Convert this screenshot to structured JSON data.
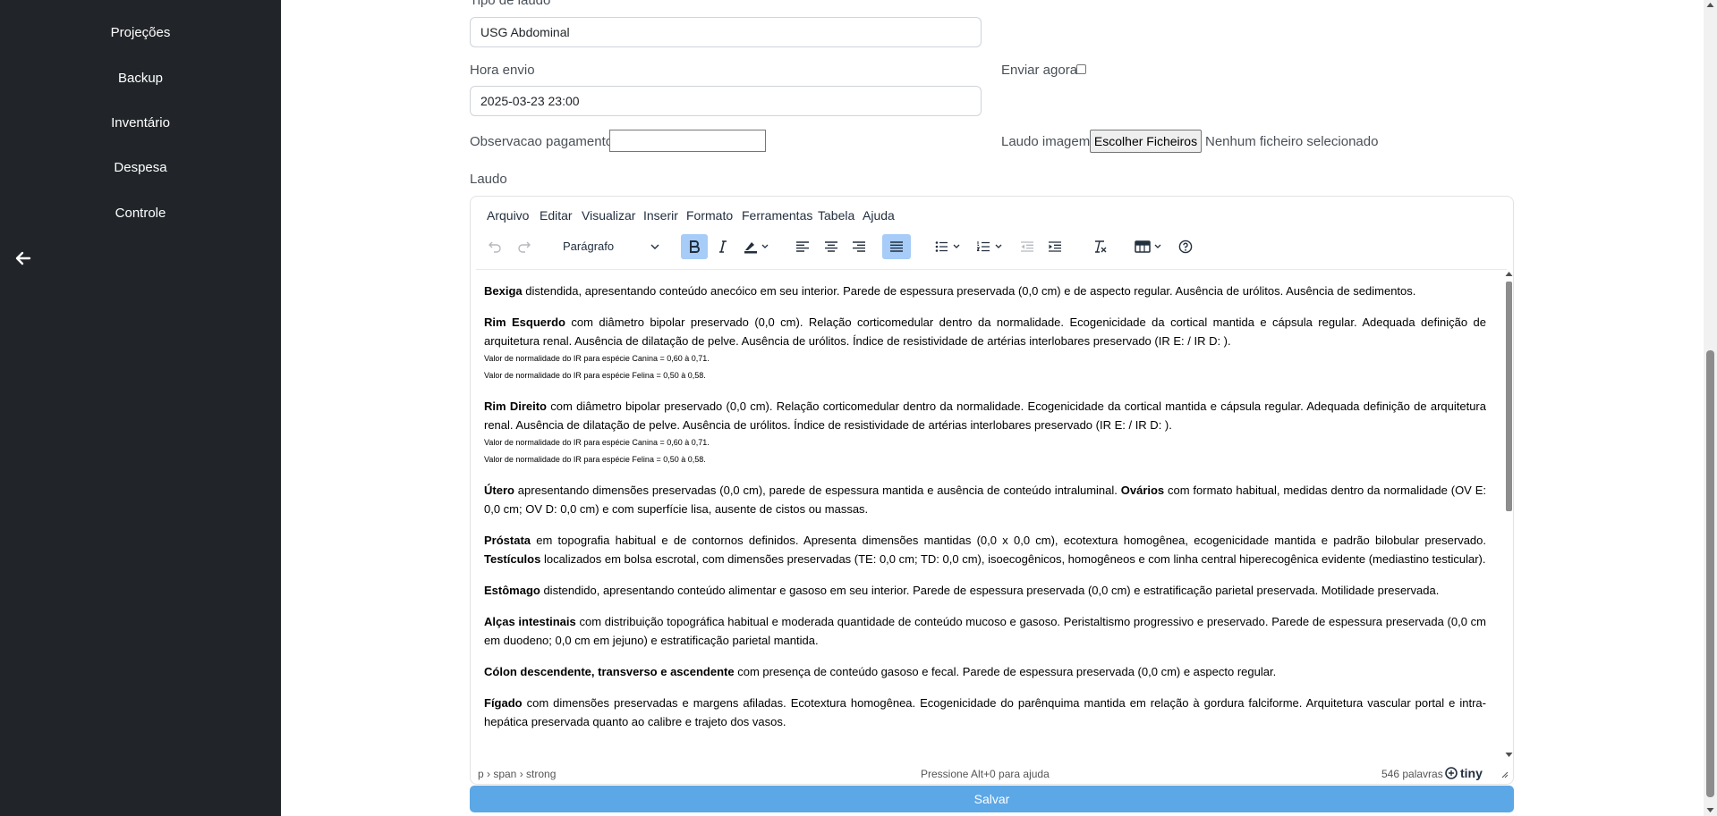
{
  "sidebar": {
    "items": [
      {
        "label": "Projeções"
      },
      {
        "label": "Backup"
      },
      {
        "label": "Inventário"
      },
      {
        "label": "Despesa"
      },
      {
        "label": "Controle"
      }
    ]
  },
  "form": {
    "tipo_label": "Tipo de laudo",
    "tipo_value": "USG Abdominal",
    "hora_label": "Hora envio",
    "hora_value": "2025-03-23 23:00",
    "enviar_label": "Enviar agora",
    "obs_label": "Observacao pagamento",
    "laudo_imagem_label": "Laudo imagem",
    "file_button": "Escolher Ficheiros",
    "file_status": "Nenhum ficheiro selecionado",
    "laudo_label": "Laudo"
  },
  "editor": {
    "menu": [
      "Arquivo",
      "Editar",
      "Visualizar",
      "Inserir",
      "Formato",
      "Ferramentas",
      "Tabela",
      "Ajuda"
    ],
    "block_format": "Parágrafo",
    "paragraphs": [
      {
        "bold": "Bexiga",
        "text": " distendida, apresentando conteúdo anecóico em seu interior. Parede de espessura preservada (0,0 cm) e de aspecto regular. Ausência de urólitos. Ausência de sedimentos."
      },
      {
        "bold": "Rim Esquerdo",
        "text": " com diâmetro bipolar preservado (0,0 cm). Relação corticomedular dentro da normalidade. Ecogenicidade da cortical mantida e cápsula regular. Adequada definição de arquitetura renal. Ausência de dilatação de pelve. Ausência de urólitos. Índice de resistividade de artérias interlobares preservado (IR E: / IR D: ).",
        "notes": [
          "Valor de normalidade do IR para espécie Canina = 0,60 à 0,71.",
          "Valor de normalidade do IR para espécie Felina = 0,50 à 0,58."
        ]
      },
      {
        "bold": "Rim Direito",
        "text": " com diâmetro bipolar preservado (0,0 cm). Relação corticomedular dentro da normalidade. Ecogenicidade da cortical mantida e cápsula regular. Adequada definição de arquitetura renal. Ausência de dilatação de pelve. Ausência de urólitos. Índice de resistividade de artérias interlobares preservado (IR E: / IR D: ).",
        "notes": [
          "Valor de normalidade do IR para espécie Canina = 0,60 à 0,71.",
          "Valor de normalidade do IR para espécie Felina = 0,50 à 0,58."
        ]
      },
      {
        "bold": "Útero",
        "text": " apresentando dimensões preservadas (0,0 cm), parede de espessura mantida e ausência de conteúdo intraluminal. ",
        "bold2": "Ovários",
        "text2": " com formato habitual, medidas dentro da normalidade (OV E: 0,0 cm; OV D: 0,0 cm) e com superfície lisa, ausente de cistos ou massas."
      },
      {
        "bold": "Próstata",
        "text": " em topografia habitual e de contornos definidos. Apresenta dimensões mantidas (0,0 x 0,0 cm), ecotextura homogênea, ecogenicidade mantida e padrão bilobular preservado. ",
        "bold2": "Testículos",
        "text2": " localizados em bolsa escrotal, com dimensões preservadas (TE: 0,0 cm; TD: 0,0 cm), isoecogênicos, homogêneos e com linha central hiperecogênica evidente (mediastino testicular)."
      },
      {
        "bold": "Estômago",
        "text": " distendido, apresentando conteúdo alimentar e gasoso em seu interior. Parede de espessura preservada (0,0 cm) e estratificação parietal preservada. Motilidade preservada."
      },
      {
        "bold": "Alças intestinais",
        "text": " com distribuição topográfica habitual e moderada quantidade de conteúdo mucoso e gasoso. Peristaltismo progressivo e preservado. Parede de espessura preservada (0,0 cm em duodeno; 0,0 cm em jejuno) e estratificação parietal mantida."
      },
      {
        "bold": "Cólon descendente, transverso e ascendente",
        "text": " com presença de conteúdo gasoso e fecal. Parede de espessura preservada (0,0 cm) e aspecto regular."
      },
      {
        "bold": "Fígado",
        "text": " com dimensões preservadas e margens afiladas. Ecotextura homogênea. Ecogenicidade do parênquima mantida em relação à gordura falciforme. Arquitetura vascular portal e intra-hepática preservada quanto ao calibre e trajeto dos vasos."
      }
    ],
    "status_path": "p › span › strong",
    "status_help": "Pressione Alt+0 para ajuda",
    "word_count": "546 palavras",
    "brand": "tiny"
  },
  "save_label": "Salvar",
  "icons": [
    "arrow-left-icon",
    "undo-icon",
    "redo-icon",
    "bold-icon",
    "italic-icon",
    "highlight-icon",
    "align-left-icon",
    "align-center-icon",
    "align-right-icon",
    "align-justify-icon",
    "bullet-list-icon",
    "numbered-list-icon",
    "outdent-icon",
    "indent-icon",
    "clear-format-icon",
    "table-icon",
    "help-icon"
  ],
  "colors": {
    "sidebar": "#212529",
    "save": "#5ca7e6",
    "active_button": "#a6ccf7"
  }
}
